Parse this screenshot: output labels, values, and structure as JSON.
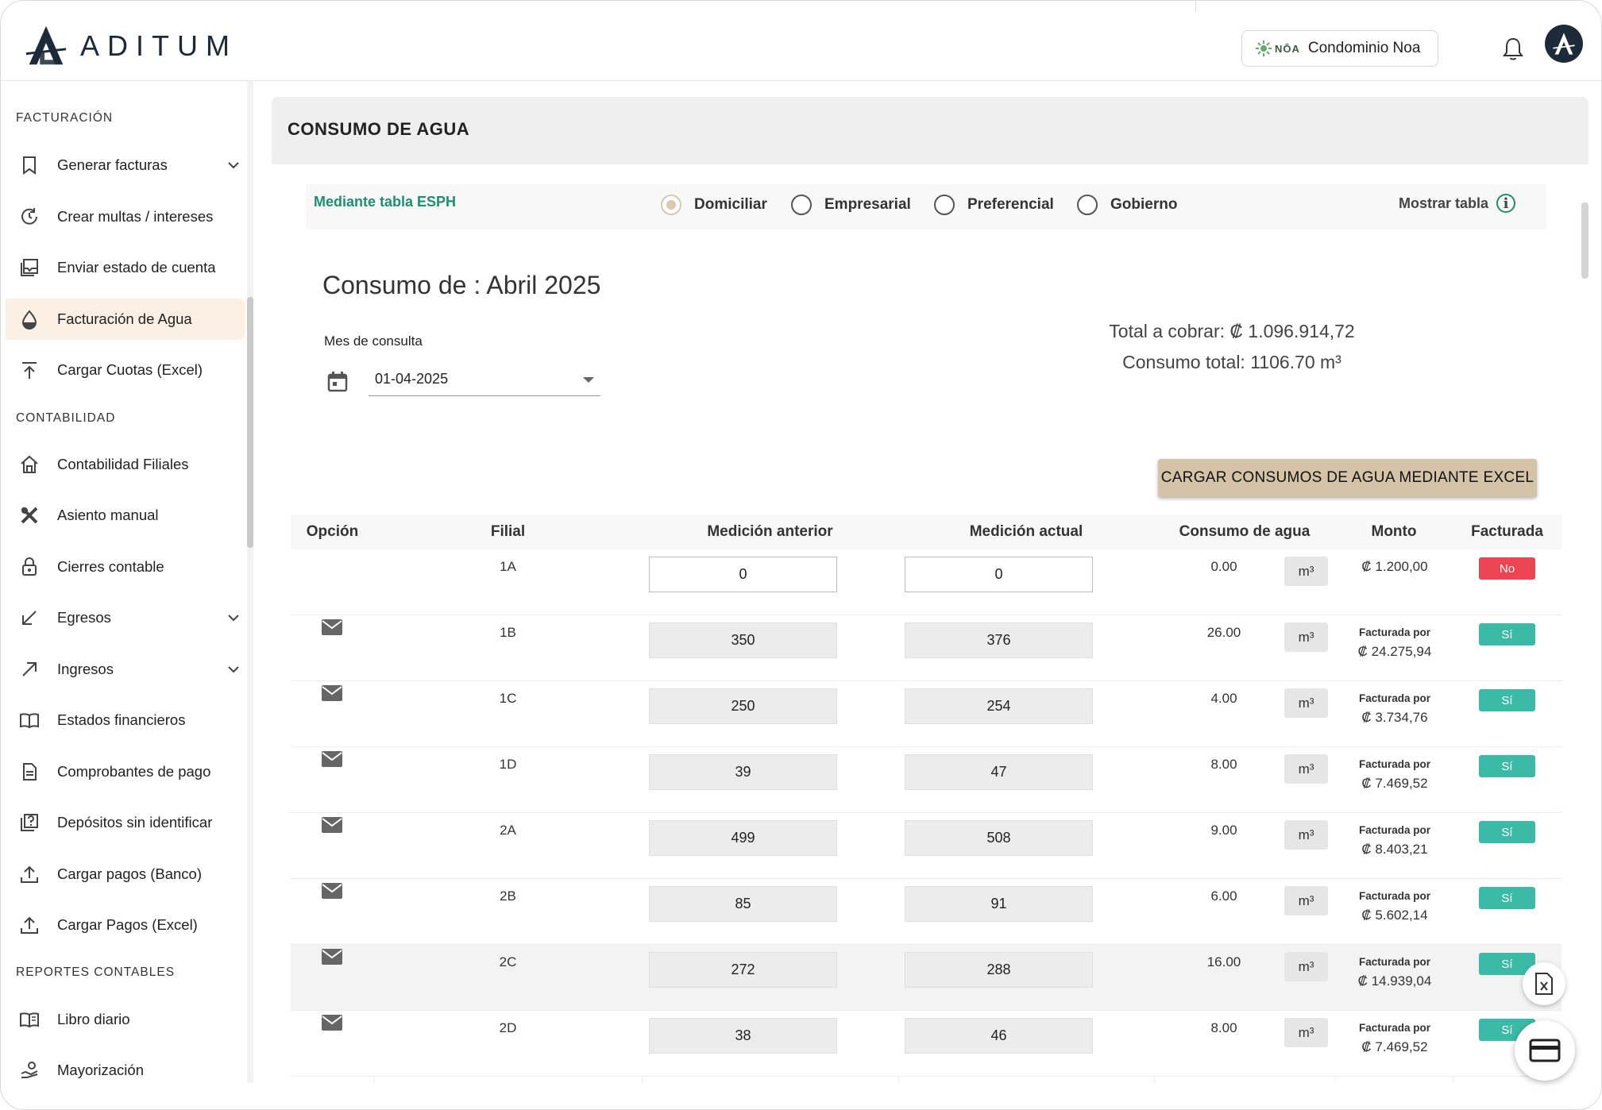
{
  "brand": {
    "name": "ADITUM"
  },
  "header": {
    "condo_chip": {
      "logo_text": "NŌA",
      "name": "Condominio Noa"
    }
  },
  "sidebar": {
    "sections": [
      {
        "title": "FACTURACIÓN",
        "items": [
          {
            "label": "Generar facturas",
            "icon": "bookmark-icon",
            "has_chevron": true,
            "active": false
          },
          {
            "label": "Crear multas / intereses",
            "icon": "refresh-clock-icon",
            "has_chevron": false,
            "active": false
          },
          {
            "label": "Enviar estado de cuenta",
            "icon": "inbox-stack-icon",
            "has_chevron": false,
            "active": false
          },
          {
            "label": "Facturación de Agua",
            "icon": "water-drop-icon",
            "has_chevron": false,
            "active": true
          },
          {
            "label": "Cargar Cuotas (Excel)",
            "icon": "upload-arrow-icon",
            "has_chevron": false,
            "active": false
          }
        ]
      },
      {
        "title": "CONTABILIDAD",
        "items": [
          {
            "label": "Contabilidad Filiales",
            "icon": "home-icon",
            "has_chevron": false,
            "active": false
          },
          {
            "label": "Asiento manual",
            "icon": "tools-icon",
            "has_chevron": false,
            "active": false
          },
          {
            "label": "Cierres contable",
            "icon": "lock-icon",
            "has_chevron": false,
            "active": false
          },
          {
            "label": "Egresos",
            "icon": "arrow-down-left-icon",
            "has_chevron": true,
            "active": false
          },
          {
            "label": "Ingresos",
            "icon": "arrow-up-right-icon",
            "has_chevron": true,
            "active": false
          },
          {
            "label": "Estados financieros",
            "icon": "book-open-icon",
            "has_chevron": false,
            "active": false
          },
          {
            "label": "Comprobantes de pago",
            "icon": "document-icon",
            "has_chevron": false,
            "active": false
          },
          {
            "label": "Depósitos sin identificar",
            "icon": "question-doc-icon",
            "has_chevron": false,
            "active": false
          },
          {
            "label": "Cargar pagos (Banco)",
            "icon": "upload-tray-icon",
            "has_chevron": false,
            "active": false
          },
          {
            "label": "Cargar Pagos (Excel)",
            "icon": "upload-tray-icon",
            "has_chevron": false,
            "active": false
          }
        ]
      },
      {
        "title": "REPORTES CONTABLES",
        "items": [
          {
            "label": "Libro diario",
            "icon": "book-lines-icon",
            "has_chevron": false,
            "active": false
          },
          {
            "label": "Mayorización",
            "icon": "hand-coin-icon",
            "has_chevron": false,
            "active": false
          }
        ]
      }
    ]
  },
  "page": {
    "title": "CONSUMO DE AGUA",
    "esph_link": "Mediante tabla ESPH",
    "tariff_options": [
      {
        "label": "Domiciliar",
        "checked": true
      },
      {
        "label": "Empresarial",
        "checked": false
      },
      {
        "label": "Preferencial",
        "checked": false
      },
      {
        "label": "Gobierno",
        "checked": false
      }
    ],
    "show_table": "Mostrar tabla",
    "consumo_title": "Consumo de : Abril 2025",
    "month_label": "Mes de consulta",
    "month_value": "01-04-2025",
    "total_cobrar": "Total a cobrar: ₡ 1.096.914,72",
    "consumo_total": "Consumo total: 1106.70 m³",
    "excel_button": "CARGAR CONSUMOS DE AGUA MEDIANTE EXCEL"
  },
  "table": {
    "headers": [
      "Opción",
      "Filial",
      "Medición anterior",
      "Medición actual",
      "Consumo de agua",
      "Monto",
      "Facturada"
    ],
    "unit": "m³",
    "billed_prefix": "Facturada por",
    "rows": [
      {
        "filial": "1A",
        "anterior": "0",
        "actual": "0",
        "consumo": "0.00",
        "monto": "₡ 1.200,00",
        "facturada": "No",
        "billed": false,
        "editable": true,
        "mail": false
      },
      {
        "filial": "1B",
        "anterior": "350",
        "actual": "376",
        "consumo": "26.00",
        "monto": "₡ 24.275,94",
        "facturada": "Sí",
        "billed": true,
        "editable": false,
        "mail": true
      },
      {
        "filial": "1C",
        "anterior": "250",
        "actual": "254",
        "consumo": "4.00",
        "monto": "₡ 3.734,76",
        "facturada": "Sí",
        "billed": true,
        "editable": false,
        "mail": true
      },
      {
        "filial": "1D",
        "anterior": "39",
        "actual": "47",
        "consumo": "8.00",
        "monto": "₡ 7.469,52",
        "facturada": "Sí",
        "billed": true,
        "editable": false,
        "mail": true
      },
      {
        "filial": "2A",
        "anterior": "499",
        "actual": "508",
        "consumo": "9.00",
        "monto": "₡ 8.403,21",
        "facturada": "Sí",
        "billed": true,
        "editable": false,
        "mail": true
      },
      {
        "filial": "2B",
        "anterior": "85",
        "actual": "91",
        "consumo": "6.00",
        "monto": "₡ 5.602,14",
        "facturada": "Sí",
        "billed": true,
        "editable": false,
        "mail": true
      },
      {
        "filial": "2C",
        "anterior": "272",
        "actual": "288",
        "consumo": "16.00",
        "monto": "₡ 14.939,04",
        "facturada": "Sí",
        "billed": true,
        "editable": false,
        "mail": true
      },
      {
        "filial": "2D",
        "anterior": "38",
        "actual": "46",
        "consumo": "8.00",
        "monto": "₡ 7.469,52",
        "facturada": "Sí",
        "billed": true,
        "editable": false,
        "mail": true
      }
    ]
  },
  "colors": {
    "accent_green": "#1d8f6f",
    "active_nav": "#fbf0e3",
    "excel_button": "#d4c3a6",
    "badge_si": "#3bbaa8",
    "badge_no": "#ec4452",
    "brand_navy": "#1d2a3a"
  }
}
